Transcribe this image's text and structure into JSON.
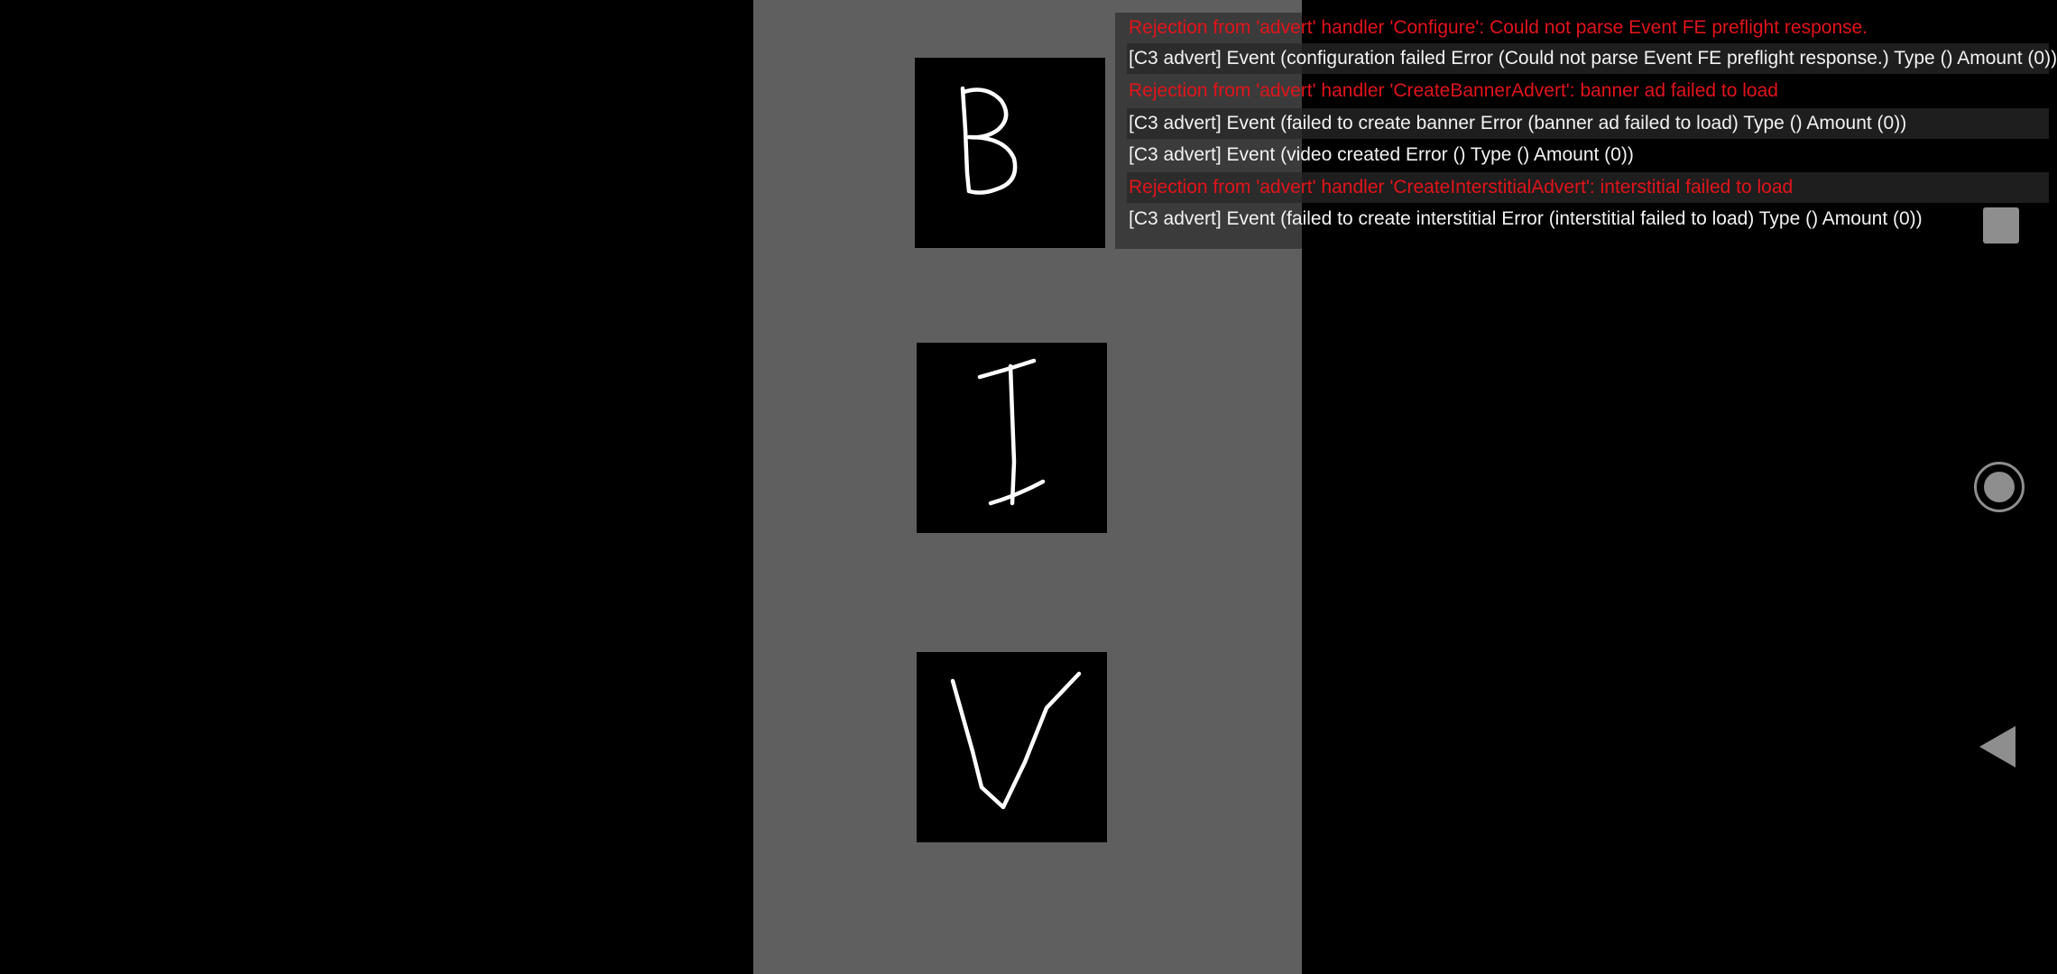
{
  "game": {
    "cards": [
      {
        "letter": "B"
      },
      {
        "letter": "I"
      },
      {
        "letter": "V"
      }
    ]
  },
  "console": {
    "lines": [
      {
        "text": "Rejection from 'advert' handler 'Configure': Could not parse Event FE preflight response.",
        "level": "error"
      },
      {
        "text": "[C3 advert] Event (configuration failed Error (Could not parse Event FE preflight response.) Type () Amount (0))",
        "level": "info"
      },
      {
        "text": "Rejection from 'advert' handler 'CreateBannerAdvert': banner ad failed to load",
        "level": "error"
      },
      {
        "text": "[C3 advert] Event (failed to create banner Error (banner ad failed to load) Type () Amount (0))",
        "level": "info"
      },
      {
        "text": "[C3 advert] Event (video created Error () Type () Amount (0))",
        "level": "info"
      },
      {
        "text": "Rejection from 'advert' handler 'CreateInterstitialAdvert': interstitial failed to load",
        "level": "error"
      },
      {
        "text": "[C3 advert] Event (failed to create interstitial Error (interstitial failed to load) Type () Amount (0))",
        "level": "info"
      }
    ]
  },
  "navigation": {
    "recents_icon": "square-icon",
    "home_icon": "circle-icon",
    "back_icon": "triangle-back-icon"
  },
  "colors": {
    "background": "#000000",
    "game_panel": "#5f5f5f",
    "error_text": "#e0141b",
    "info_text": "#f2f2f2",
    "nav_icons": "#8e8e8e"
  }
}
